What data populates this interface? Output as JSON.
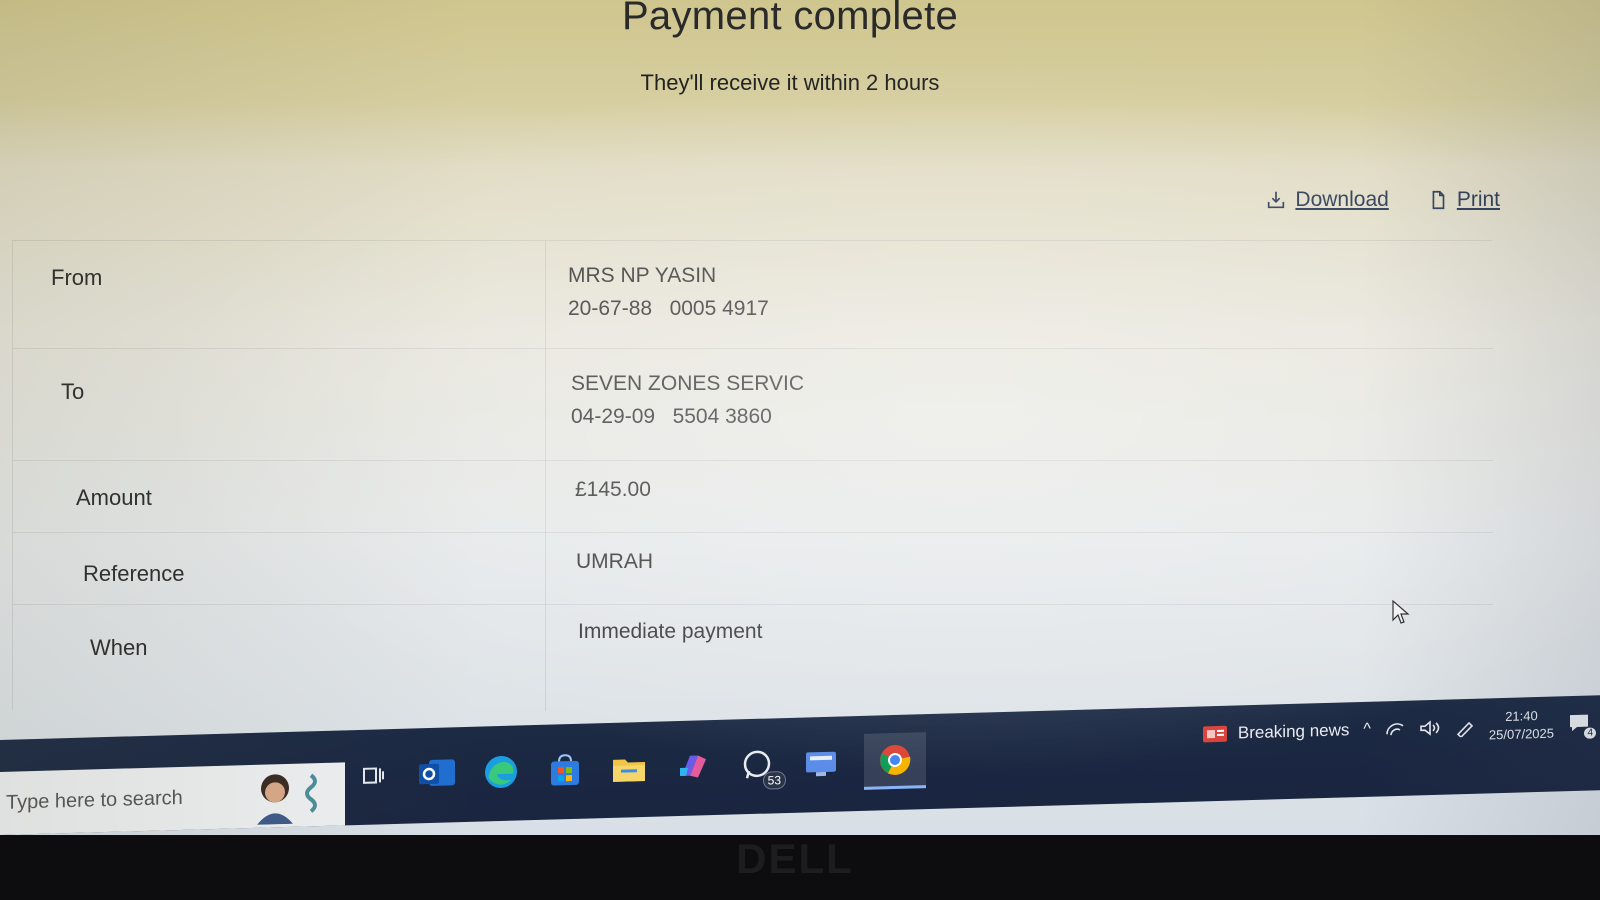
{
  "header": {
    "title": "Payment complete",
    "subtitle": "They'll receive it within 2 hours"
  },
  "actions": {
    "download_label": "Download",
    "print_label": "Print"
  },
  "details": {
    "from": {
      "label": "From",
      "name": "MRS NP YASIN",
      "sort_code": "20-67-88",
      "account": "0005 4917"
    },
    "to": {
      "label": "To",
      "name": "SEVEN ZONES SERVIC",
      "sort_code": "04-29-09",
      "account": "5504 3860"
    },
    "amount": {
      "label": "Amount",
      "value": "£145.00"
    },
    "reference": {
      "label": "Reference",
      "value": "UMRAH"
    },
    "when": {
      "label": "When",
      "value": "Immediate payment"
    }
  },
  "taskbar": {
    "search_placeholder": "Type here to search",
    "whatsapp_badge": "53",
    "news_label": "Breaking news",
    "time": "21:40",
    "date": "25/07/2025",
    "notifications_count": "4",
    "icons": [
      "task-view-icon",
      "outlook-icon",
      "edge-icon",
      "store-icon",
      "file-explorer-icon",
      "copilot-icon",
      "whatsapp-icon",
      "teams-icon",
      "chrome-icon"
    ]
  },
  "brand": "DELL"
}
